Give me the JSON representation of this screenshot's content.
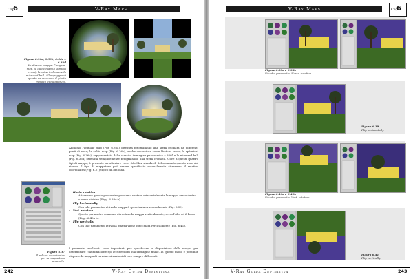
{
  "header": {
    "title_left": "V-Ray Maps",
    "title_right": "V-Ray Maps",
    "chapter_prefix_left": "Cap.",
    "chapter_num_left": "6",
    "chapter_prefix_right": "Cap.",
    "chapter_num_right": "6"
  },
  "footer": {
    "page_left": "242",
    "page_right": "243",
    "title_left": "V-Ray Guida Definitiva",
    "title_right": "V-Ray Guida Definitiva"
  },
  "left": {
    "fig_caption_top": {
      "label": "Figure 6.36a, 6.36b, 6.36c e 6.36d",
      "text": "Le diverse mappe: l'angular map, la cubic map (a vertical cross), la spherical map e la mirrored ball. All'appoggio di queste va associato il giusto metodo di mappatura."
    },
    "body": "Abbiamo l'angular map (Fig. 6.36a) ottenuta fotografando una sfera cromata da differenti punti di vista; la cubic map (Fig. 6.36b), anche conosciuta come Vertical cross; la spherical map (Fig. 6.36c), rappresentata dalla classica immagine panoramica a 360° e la mirrored ball (Fig. 6.36d) ottenuta semplicemente fotografando una sfera cromata. Oltre a questi quattro tipi di mappa, è presente un ulteriore voce, 3ds Max standard. Selezionando questa voce dal viewer, il tipo di mappatura può essere specificato manualmente attraverso il relativo coordinates (Fig. 6.37) tipico di 3ds Max.",
    "bullets": [
      {
        "title": "Horiz. rotation",
        "desc": "Attraverso questo parametro possiamo ruotare orizzontalmente la mappa verso destra o verso sinistra (Figg. 6.38a-b)."
      },
      {
        "title": "Flip horizontally",
        "desc": "Con tale parametro attivo la mappa è specchiata orizzontalmente (Fig. 6.39)."
      },
      {
        "title": "Vert. rotation",
        "desc": "Questo parametro consente di ruotare la mappa verticalmente, verso l'alto ed il basso (Figg. 6.40a-b)."
      },
      {
        "title": "Flip vertically",
        "desc": "Con tale parametro attivo la mappa viene specchiata verticalmente (Fig. 6.41)."
      }
    ],
    "closing": "I parametri analizzati sono importanti per specificare la disposizione della mappa per determinare l'illuminazione e/o le riflessioni sull'immagine finale. In questo modo è possibile disporre la mappa di termine situazioni di luce sempre differenti.",
    "fig_637": {
      "label": "Figura 6.37",
      "text": "Il rollout coordinates per la mappatura manuale."
    }
  },
  "right": {
    "cap_638": {
      "label": "Figure 6.38a e 6.38b",
      "text": "Uso del parametro Horiz. rotation."
    },
    "cap_639": {
      "label": "Figura 6.39",
      "text": "Flip horizontally."
    },
    "cap_640": {
      "label": "Figure 6.40a e 6.40b",
      "text": "Uso del parametro Vert. rotation."
    },
    "cap_641": {
      "label": "Figura 6.41",
      "text": "Flip vertically."
    }
  }
}
